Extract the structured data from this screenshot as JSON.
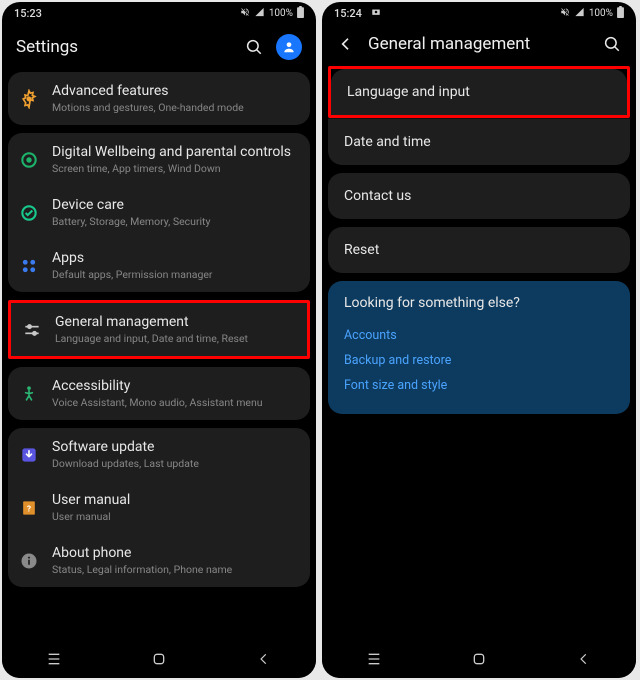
{
  "left": {
    "status": {
      "time": "15:23",
      "battery": "100%"
    },
    "header": {
      "title": "Settings"
    },
    "items": [
      {
        "icon": "advanced",
        "title": "Advanced features",
        "sub": "Motions and gestures, One-handed mode"
      },
      {
        "icon": "wellbeing",
        "title": "Digital Wellbeing and parental controls",
        "sub": "Screen time, App timers, Wind Down"
      },
      {
        "icon": "devicecare",
        "title": "Device care",
        "sub": "Battery, Storage, Memory, Security"
      },
      {
        "icon": "apps",
        "title": "Apps",
        "sub": "Default apps, Permission manager"
      },
      {
        "icon": "general",
        "title": "General management",
        "sub": "Language and input, Date and time, Reset"
      },
      {
        "icon": "accessibility",
        "title": "Accessibility",
        "sub": "Voice Assistant, Mono audio, Assistant menu"
      },
      {
        "icon": "update",
        "title": "Software update",
        "sub": "Download updates, Last update"
      },
      {
        "icon": "manual",
        "title": "User manual",
        "sub": "User manual"
      },
      {
        "icon": "about",
        "title": "About phone",
        "sub": "Status, Legal information, Phone name"
      }
    ]
  },
  "right": {
    "status": {
      "time": "15:24",
      "battery": "100%"
    },
    "header": {
      "title": "General management"
    },
    "items": [
      {
        "title": "Language and input"
      },
      {
        "title": "Date and time"
      },
      {
        "title": "Contact us"
      },
      {
        "title": "Reset"
      }
    ],
    "suggest": {
      "title": "Looking for something else?",
      "links": [
        "Accounts",
        "Backup and restore",
        "Font size and style"
      ]
    }
  }
}
